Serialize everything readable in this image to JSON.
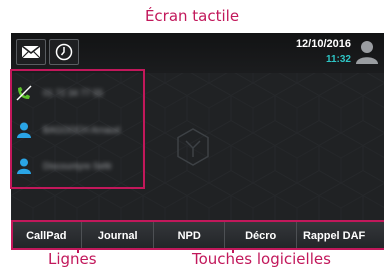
{
  "callouts": {
    "top": "Écran tactile",
    "lines": "Lignes",
    "softkeys": "Touches logicielles"
  },
  "status_bar": {
    "date": "12/10/2016",
    "time": "11:32",
    "icons": [
      "envelope-icon",
      "clock-icon",
      "user-avatar-icon"
    ],
    "time_color": "#2ec4c4"
  },
  "lines": [
    {
      "label": "01 72 34 77 55",
      "icon": "phone-handset-icon",
      "icon_color": "#5cc12a"
    },
    {
      "label": "BAGOOCH Arnaud",
      "icon": "contact-person-icon",
      "icon_color": "#2aa5e6"
    },
    {
      "label": "Discountyre Sefé",
      "icon": "contact-person-icon",
      "icon_color": "#2aa5e6"
    }
  ],
  "softkeys": [
    "CallPad",
    "Journal",
    "NPD",
    "Décro",
    "Rappel DAF"
  ],
  "colors": {
    "screen_bg": "#202224",
    "highlight": "#c2185b",
    "softkey_text": "#ffffff"
  }
}
